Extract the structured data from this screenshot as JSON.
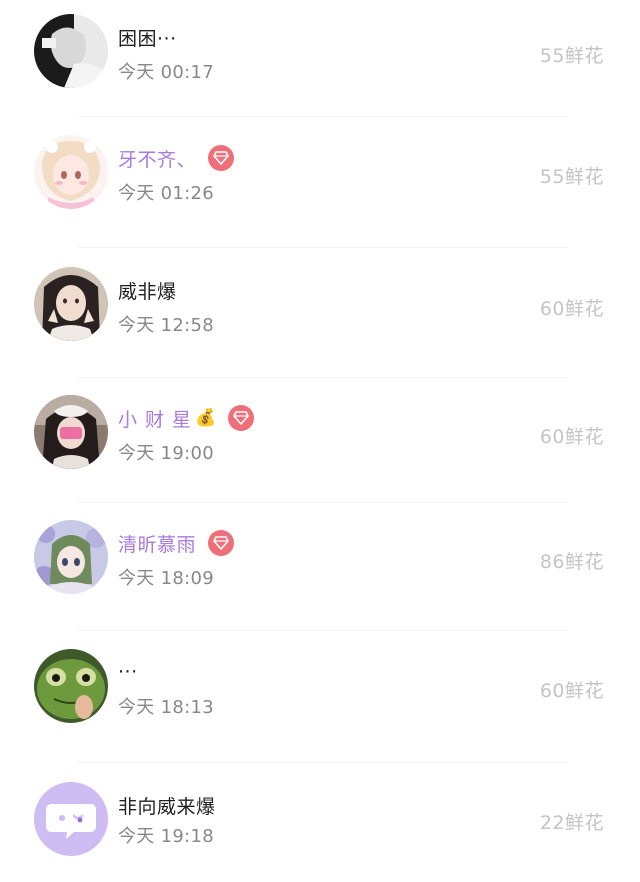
{
  "rows": [
    {
      "name": "困困···",
      "time": "今天 00:17",
      "flowers": "55鲜花",
      "vip": false,
      "gem": false
    },
    {
      "name": "牙不齐、",
      "time": "今天 01:26",
      "flowers": "55鲜花",
      "vip": true,
      "gem": true
    },
    {
      "name": "威非爆",
      "time": "今天 12:58",
      "flowers": "60鲜花",
      "vip": false,
      "gem": false
    },
    {
      "name": "小财星",
      "name_suffix": "💰",
      "time": "今天 19:00",
      "flowers": "60鲜花",
      "vip": true,
      "gem": true
    },
    {
      "name": "清昕慕雨",
      "time": "今天 18:09",
      "flowers": "86鲜花",
      "vip": true,
      "gem": true
    },
    {
      "name": "···",
      "time": "今天 18:13",
      "flowers": "60鲜花",
      "vip": false,
      "gem": false
    },
    {
      "name": "非向威来爆",
      "time": "今天 19:18",
      "flowers": "22鲜花",
      "vip": false,
      "gem": false
    }
  ],
  "colors": {
    "vip_name": "#a97ae0",
    "gem_badge": "#ee6f79",
    "flower_text": "#c4c4c4",
    "time_text": "#888888"
  },
  "icons": {
    "vip_badge": "diamond-badge-icon",
    "money_bag": "money-bag-icon",
    "default_avatar": "chat-bubble-icon"
  }
}
